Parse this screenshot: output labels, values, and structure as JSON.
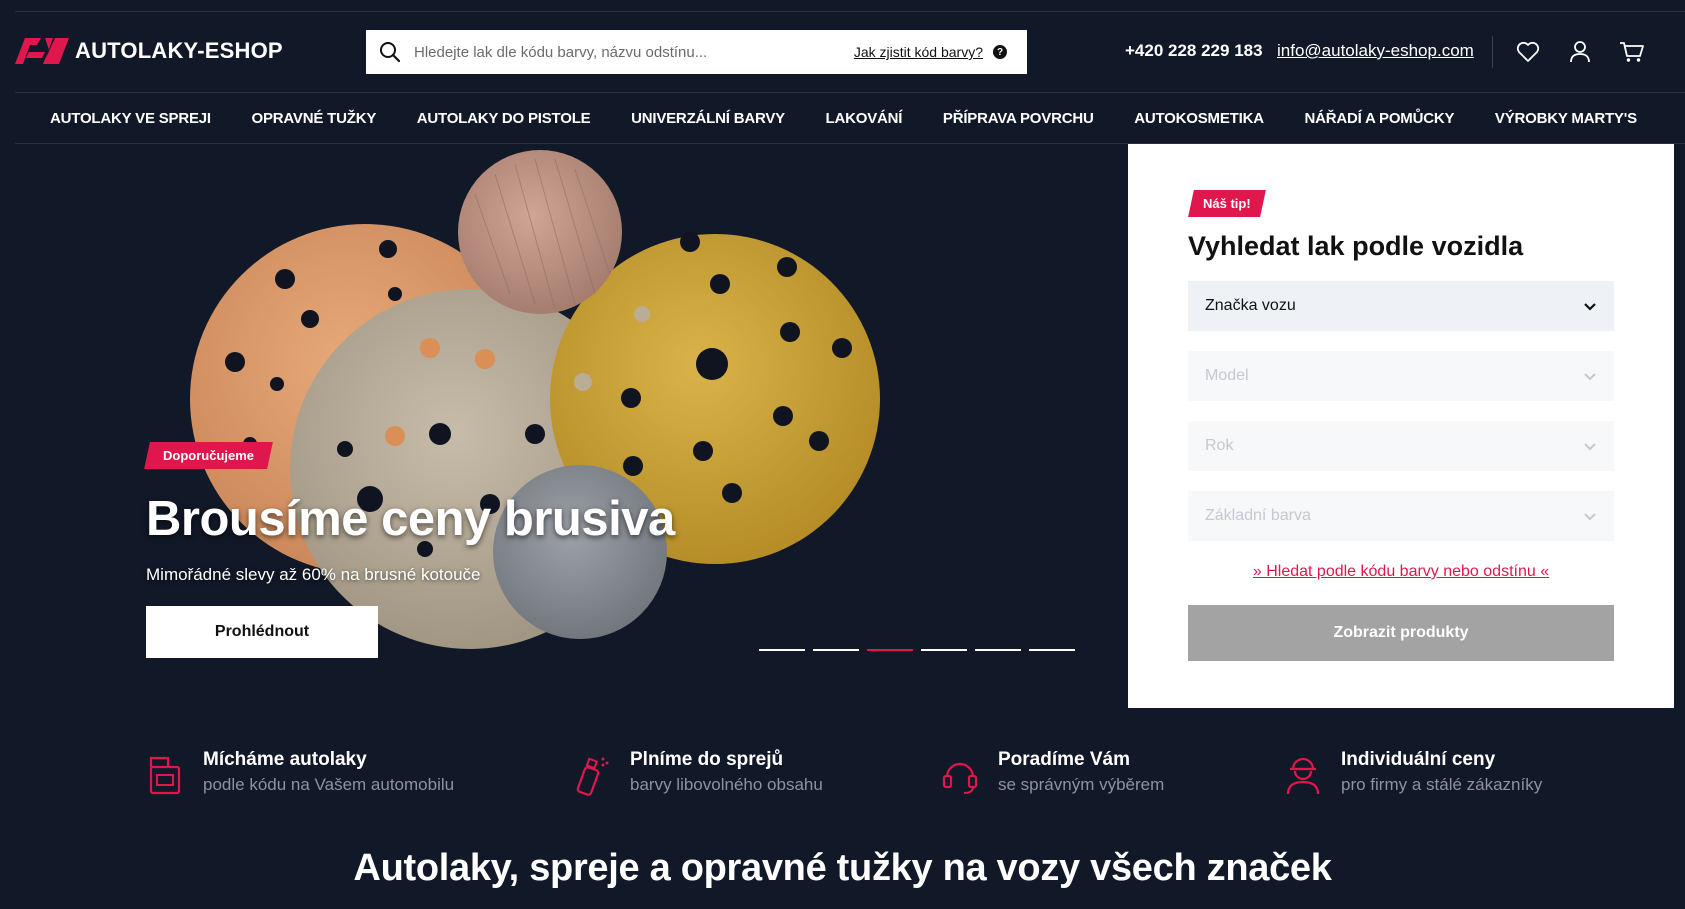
{
  "header": {
    "logo_text": "AUTOLAKY-ESHOP",
    "search_placeholder": "Hledejte lak dle kódu barvy, názvu odstínu...",
    "search_help_link": "Jak zjistit kód barvy?",
    "phone": "+420 228 229 183",
    "email": "info@autolaky-eshop.com",
    "icons": [
      "heart-icon",
      "user-icon",
      "cart-icon"
    ]
  },
  "nav": {
    "items": [
      {
        "label": "AUTOLAKY VE SPREJI"
      },
      {
        "label": "OPRAVNÉ TUŽKY"
      },
      {
        "label": "AUTOLAKY DO PISTOLE"
      },
      {
        "label": "UNIVERZÁLNÍ BARVY"
      },
      {
        "label": "LAKOVÁNÍ"
      },
      {
        "label": "PŘÍPRAVA POVRCHU"
      },
      {
        "label": "AUTOKOSMETIKA"
      },
      {
        "label": "NÁŘADÍ A POMŮCKY"
      },
      {
        "label": "VÝROBKY MARTY'S"
      }
    ]
  },
  "hero": {
    "badge": "Doporučujeme",
    "title": "Brousíme ceny brusiva",
    "subtitle": "Mimořádné slevy až 60% na brusné kotouče",
    "button": "Prohlédnout",
    "slide_count": 6,
    "active_slide": 3
  },
  "vehicle_search": {
    "badge": "Náš tip!",
    "title": "Vyhledat lak podle vozidla",
    "selects": [
      {
        "label": "Značka vozu"
      },
      {
        "label": "Model"
      },
      {
        "label": "Rok"
      },
      {
        "label": "Základní barva"
      }
    ],
    "link": "» Hledat podle kódu barvy nebo odstínu «",
    "button": "Zobrazit produkty"
  },
  "features": [
    {
      "icon": "paint-bucket-icon",
      "title": "Mícháme autolaky",
      "subtitle": "podle kódu na Vašem automobilu"
    },
    {
      "icon": "spray-can-icon",
      "title": "Plníme do sprejů",
      "subtitle": "barvy libovolného obsahu"
    },
    {
      "icon": "headset-icon",
      "title": "Poradíme Vám",
      "subtitle": "se správným výběrem"
    },
    {
      "icon": "worker-icon",
      "title": "Individuální ceny",
      "subtitle": "pro firmy a stálé zákazníky"
    }
  ],
  "section_title": "Autolaky, spreje a opravné tužky na vozy všech značek",
  "colors": {
    "background": "#111827",
    "accent": "#e0174d",
    "button_disabled": "#a3a3a3"
  }
}
